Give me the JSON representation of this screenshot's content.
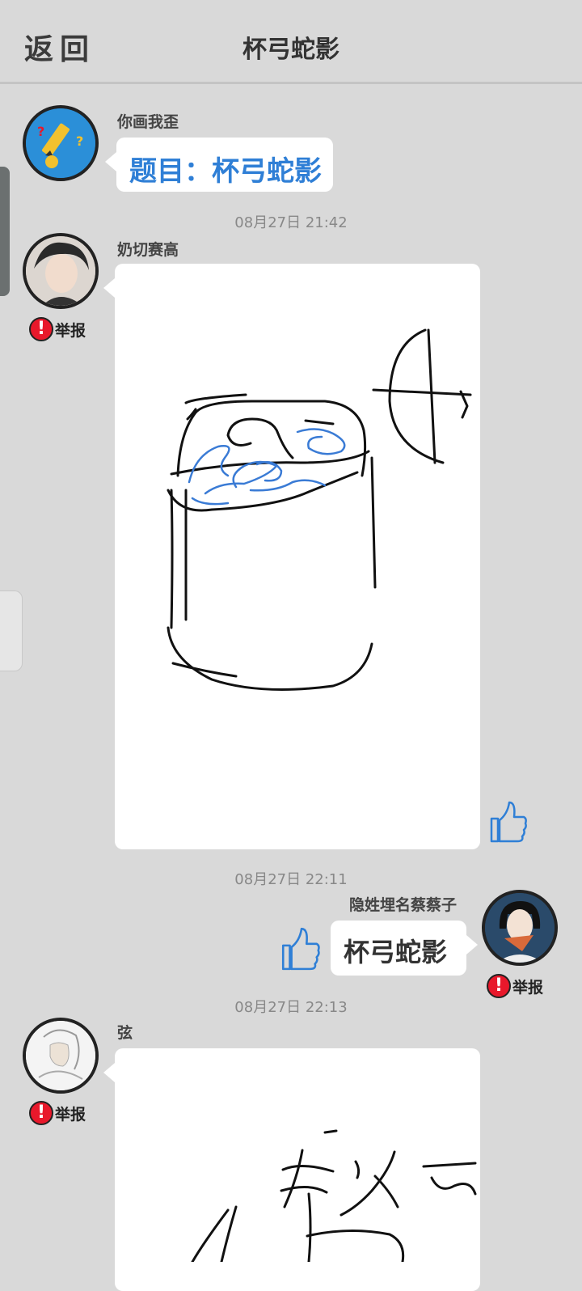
{
  "header": {
    "back_label": "返回",
    "title": "杯弓蛇影"
  },
  "messages": [
    {
      "sender": "你画我歪",
      "text": "题目：杯弓蛇影"
    },
    {
      "time": "08月27日  21:42",
      "sender": "奶切赛高",
      "report": "举报"
    },
    {
      "time": "08月27日  22:11",
      "sender": "隐姓埋名蔡蔡子",
      "text": "杯弓蛇影",
      "report": "举报"
    },
    {
      "time": "08月27日  22:13",
      "sender": "弦",
      "report": "举报"
    }
  ],
  "icons": {
    "report": "exclamation-icon",
    "like": "thumbs-up-icon"
  },
  "colors": {
    "background": "#d9d9d9",
    "topic_text": "#2f7fd6",
    "report_badge": "#e8182b",
    "thumb": "#2f7fd6"
  }
}
